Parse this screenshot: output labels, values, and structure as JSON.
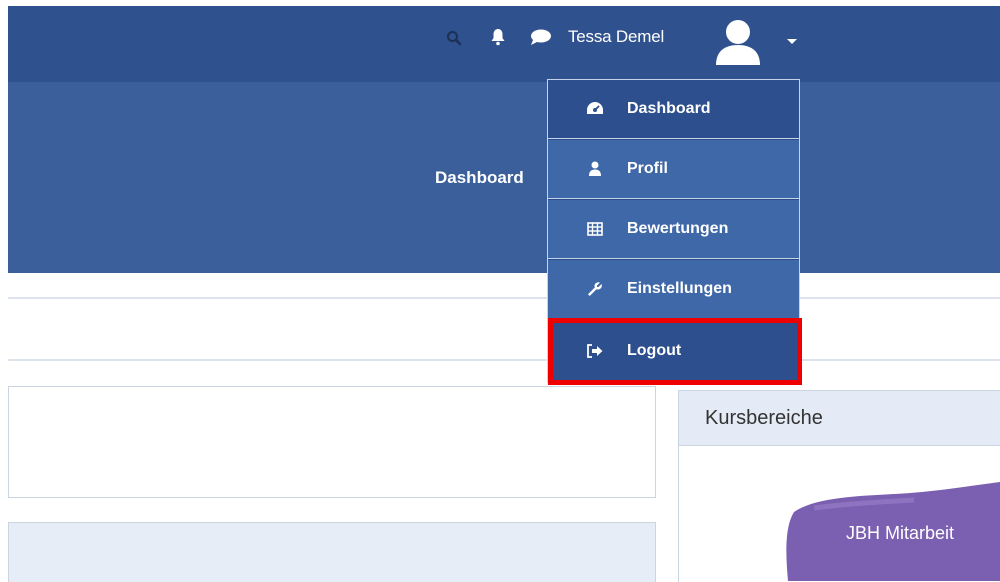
{
  "topbar": {
    "user_name": "Tessa Demel",
    "icons": [
      "search-icon",
      "bell-icon",
      "chat-icon",
      "user-avatar-icon",
      "caret-down-icon"
    ]
  },
  "header": {
    "title": "Dashboard"
  },
  "user_menu": {
    "items": [
      {
        "label": "Dashboard",
        "icon": "dashboard-icon"
      },
      {
        "label": "Profil",
        "icon": "user-icon"
      },
      {
        "label": "Bewertungen",
        "icon": "grid-table-icon"
      },
      {
        "label": "Einstellungen",
        "icon": "wrench-icon"
      },
      {
        "label": "Logout",
        "icon": "logout-icon"
      }
    ]
  },
  "sidebar": {
    "card_title": "Kursbereiche",
    "course_label": "JBH Mitarbeit"
  },
  "colors": {
    "topbar": "#2f528f",
    "header": "#3a5f9b",
    "highlight": "#ef0000"
  }
}
